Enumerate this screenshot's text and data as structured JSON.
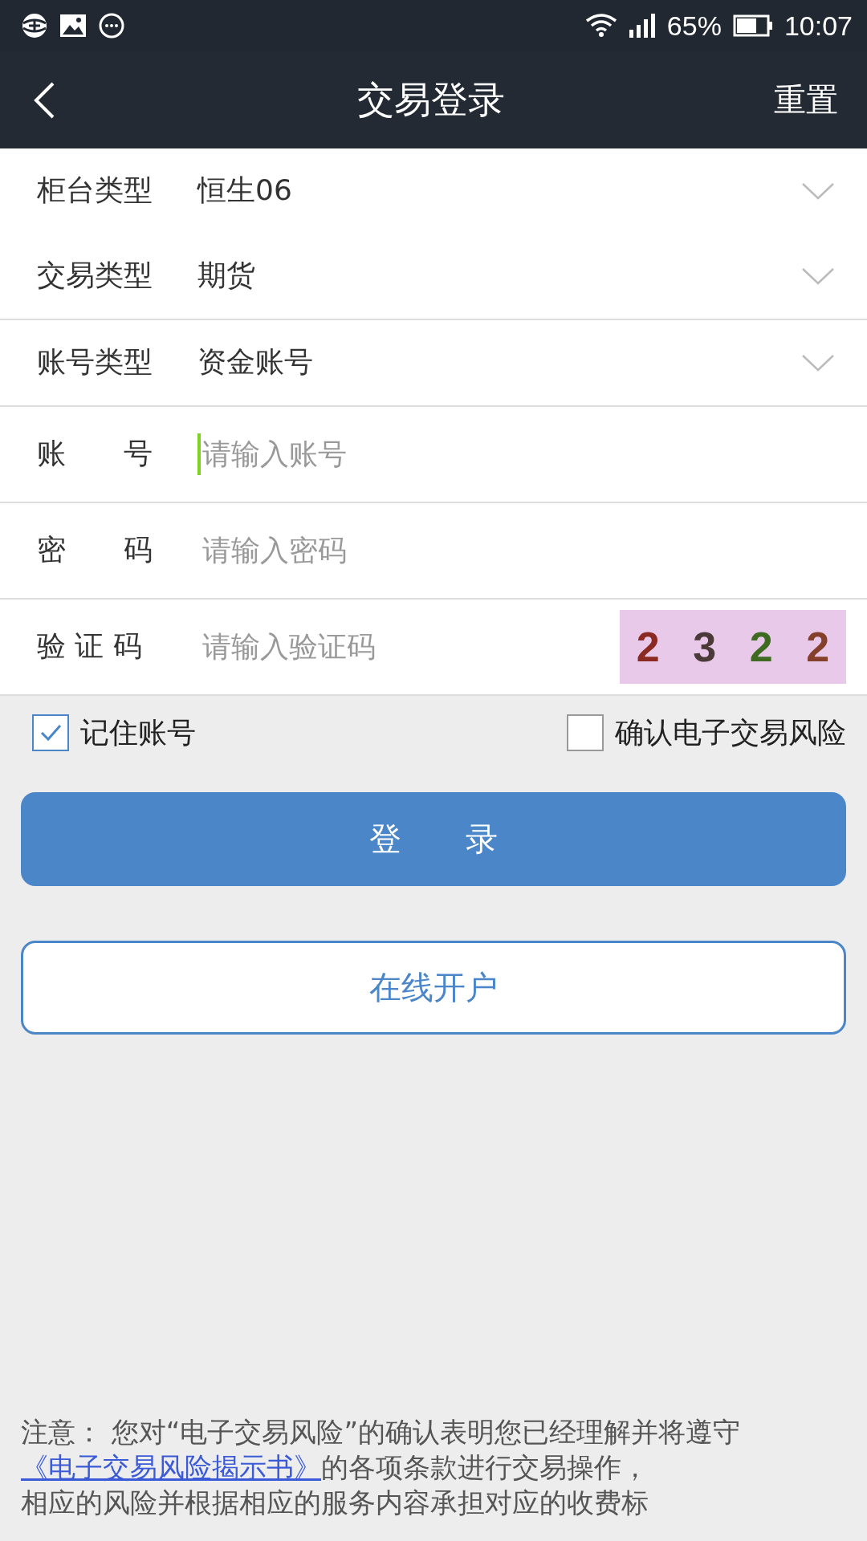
{
  "status_bar": {
    "battery_text": "65%",
    "time": "10:07"
  },
  "nav": {
    "title": "交易登录",
    "action": "重置"
  },
  "form": [
    {
      "kind": "select",
      "label": "柜台类型",
      "value": "恒生06",
      "divider": false
    },
    {
      "kind": "select",
      "label": "交易类型",
      "value": "期货",
      "divider": false
    },
    {
      "kind": "select",
      "label": "账号类型",
      "value": "资金账号",
      "divider": true
    },
    {
      "kind": "input",
      "label": "账　　号",
      "placeholder": "请输入账号",
      "focused": true,
      "divider": true
    },
    {
      "kind": "input",
      "label": "密　　码",
      "placeholder": "请输入密码",
      "focused": false,
      "divider": true
    },
    {
      "kind": "captcha",
      "label": "验 证 码",
      "placeholder": "请输入验证码",
      "focused": false,
      "divider": true,
      "digits": [
        {
          "text": "2",
          "color": "#8b2a22"
        },
        {
          "text": "3",
          "color": "#4a3a38"
        },
        {
          "text": "2",
          "color": "#3f6a22"
        },
        {
          "text": "2",
          "color": "#84402a"
        }
      ]
    }
  ],
  "checkboxes": [
    {
      "label": "记住账号",
      "checked": true
    },
    {
      "label": "确认电子交易风险",
      "checked": false
    }
  ],
  "login_button": "登　　录",
  "open_account_button": "在线开户",
  "notice": {
    "prefix": "注意：  您对“电子交易风险”的确认表明您已经理解并将遵守",
    "link": "《电子交易风险揭示书》",
    "suffix": "的各项条款进行交易操作，",
    "line3": "相应的风险并根据相应的服务内容承担对应的收费标"
  }
}
